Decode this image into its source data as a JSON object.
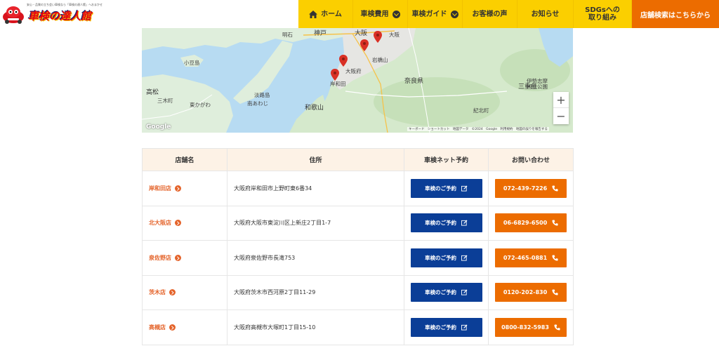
{
  "header": {
    "logo_tagline": "安心・品質の立ち会い車検なら「車検の達人館」へおまかせ",
    "logo_text": "車検の達人館",
    "nav": [
      {
        "label": "ホーム",
        "icon": "home-icon"
      },
      {
        "label": "車検費用",
        "dropdown": true
      },
      {
        "label": "車検ガイド",
        "dropdown": true
      },
      {
        "label": "お客様の声"
      },
      {
        "label": "お知らせ"
      },
      {
        "label": "SDGsへの取り組み"
      }
    ],
    "search_label": "店舗検索はこちらから"
  },
  "map": {
    "labels": [
      "明石",
      "神戸",
      "大阪",
      "大阪",
      "岸和田",
      "大阪府",
      "岩橋山",
      "小豆島",
      "高松",
      "三木町",
      "東かがわ",
      "淡路島",
      "南あわじ",
      "和歌山",
      "奈良県",
      "三重県",
      "伊勢志摩国立公園",
      "紀北町"
    ],
    "zoom_in": "+",
    "zoom_out": "−",
    "google": "Google",
    "attribution": "キーボード ショートカット 地図データ ©2024 Google 利用規約 地図の誤りを報告する",
    "pin_color": "#d93025"
  },
  "stores_table": {
    "headers": [
      "店舗名",
      "住所",
      "車検ネット予約",
      "お問い合わせ"
    ],
    "reserve_label": "車検のご予約",
    "rows": [
      {
        "name": "岸和田店",
        "address": "大阪府岸和田市上野町東6番34",
        "phone": "072-439-7226"
      },
      {
        "name": "北大阪店",
        "address": "大阪府大阪市東淀川区上新庄2丁目1-7",
        "phone": "06-6829-6500"
      },
      {
        "name": "泉佐野店",
        "address": "大阪府泉佐野市長滝753",
        "phone": "072-465-0881"
      },
      {
        "name": "茨木店",
        "address": "大阪府茨木市西河原2丁目11-29",
        "phone": "0120-202-830"
      },
      {
        "name": "高槻店",
        "address": "大阪府高槻市大塚町1丁目15-10",
        "phone": "0800-832-5983"
      }
    ]
  },
  "colors": {
    "nav_yellow": "#fbcf00",
    "accent_orange": "#ec6c00",
    "reserve_blue": "#0b3e97",
    "header_bg": "#fdf2e6"
  }
}
